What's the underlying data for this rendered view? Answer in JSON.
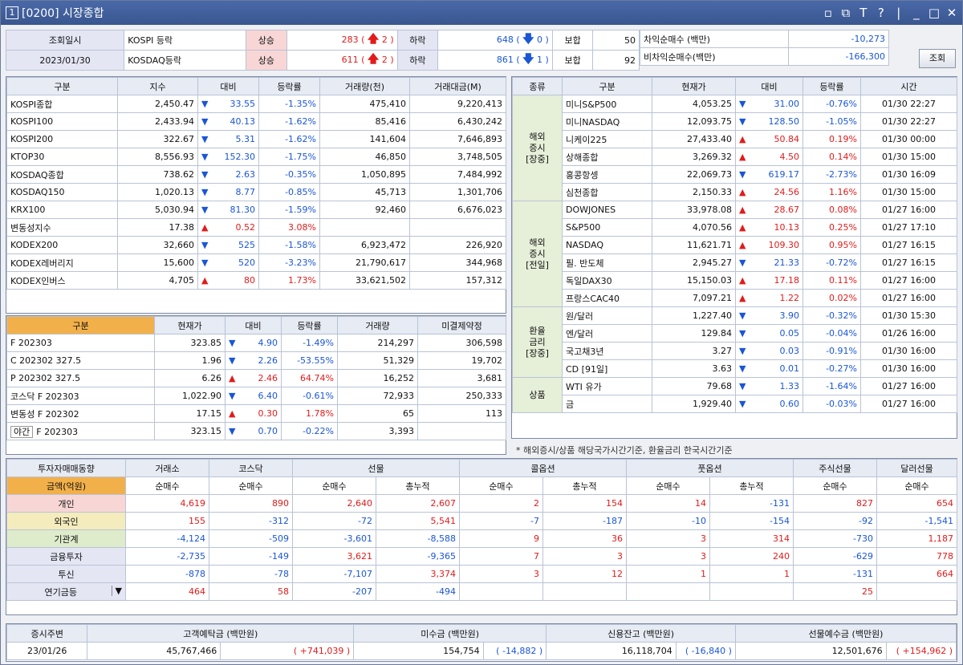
{
  "window": {
    "num": "1",
    "title": "[0200] 시장종합",
    "controls": [
      "⧉",
      "⧉",
      "T",
      "?",
      "|",
      "_",
      "□",
      "✕"
    ]
  },
  "top": {
    "date_label": "조회일시",
    "date": "2023/01/30",
    "rows": [
      {
        "name": "KOSPI 등락",
        "up_label": "상승",
        "up": "283",
        "up_limit": "2",
        "dn_label": "하락",
        "dn": "648",
        "dn_limit": "0",
        "flat_label": "보합",
        "flat": "50"
      },
      {
        "name": "KOSDAQ등락",
        "up_label": "상승",
        "up": "611",
        "up_limit": "2",
        "dn_label": "하락",
        "dn": "861",
        "dn_limit": "1",
        "flat_label": "보합",
        "flat": "92"
      }
    ],
    "arb": [
      {
        "label": "차익순매수  (백만)",
        "value": "-10,273"
      },
      {
        "label": "비차익순매수(백만)",
        "value": "-166,300"
      }
    ],
    "query_button": "조회"
  },
  "index": {
    "headers": [
      "구분",
      "지수",
      "대비",
      "등락률",
      "거래량(천)",
      "거래대금(M)"
    ],
    "rows": [
      {
        "name": "KOSPI종합",
        "val": "2,450.47",
        "dir": "dn",
        "chg": "33.55",
        "rate": "-1.35%",
        "vol": "475,410",
        "amt": "9,220,413"
      },
      {
        "name": "KOSPI100",
        "val": "2,433.94",
        "dir": "dn",
        "chg": "40.13",
        "rate": "-1.62%",
        "vol": "85,416",
        "amt": "6,430,242"
      },
      {
        "name": "KOSPI200",
        "val": "322.67",
        "dir": "dn",
        "chg": "5.31",
        "rate": "-1.62%",
        "vol": "141,604",
        "amt": "7,646,893"
      },
      {
        "name": "KTOP30",
        "val": "8,556.93",
        "dir": "dn",
        "chg": "152.30",
        "rate": "-1.75%",
        "vol": "46,850",
        "amt": "3,748,505"
      },
      {
        "name": "KOSDAQ종합",
        "val": "738.62",
        "dir": "dn",
        "chg": "2.63",
        "rate": "-0.35%",
        "vol": "1,050,895",
        "amt": "7,484,992"
      },
      {
        "name": "KOSDAQ150",
        "val": "1,020.13",
        "dir": "dn",
        "chg": "8.77",
        "rate": "-0.85%",
        "vol": "45,713",
        "amt": "1,301,706"
      },
      {
        "name": "KRX100",
        "val": "5,030.94",
        "dir": "dn",
        "chg": "81.30",
        "rate": "-1.59%",
        "vol": "92,460",
        "amt": "6,676,023"
      },
      {
        "name": "변동성지수",
        "val": "17.38",
        "dir": "up",
        "chg": "0.52",
        "rate": "3.08%",
        "vol": "",
        "amt": ""
      },
      {
        "name": "KODEX200",
        "val": "32,660",
        "dir": "dn",
        "chg": "525",
        "rate": "-1.58%",
        "vol": "6,923,472",
        "amt": "226,920"
      },
      {
        "name": "KODEX레버리지",
        "val": "15,600",
        "dir": "dn",
        "chg": "520",
        "rate": "-3.23%",
        "vol": "21,790,617",
        "amt": "344,968"
      },
      {
        "name": "KODEX인버스",
        "val": "4,705",
        "dir": "up",
        "chg": "80",
        "rate": "1.73%",
        "vol": "33,621,502",
        "amt": "157,312"
      }
    ]
  },
  "futures": {
    "headers": [
      "구분",
      "현재가",
      "대비",
      "등락률",
      "거래량",
      "미결제약정"
    ],
    "rows": [
      {
        "name": "F 202303",
        "val": "323.85",
        "dir": "dn",
        "chg": "4.90",
        "rate": "-1.49%",
        "vol": "214,297",
        "oi": "306,598"
      },
      {
        "name": "C 202302 327.5",
        "val": "1.96",
        "dir": "dn",
        "chg": "2.26",
        "rate": "-53.55%",
        "vol": "51,329",
        "oi": "19,702"
      },
      {
        "name": "P 202302 327.5",
        "val": "6.26",
        "dir": "up",
        "chg": "2.46",
        "rate": "64.74%",
        "vol": "16,252",
        "oi": "3,681"
      },
      {
        "name": "코스닥 F 202303",
        "val": "1,022.90",
        "dir": "dn",
        "chg": "6.40",
        "rate": "-0.61%",
        "vol": "72,933",
        "oi": "250,333"
      },
      {
        "name": "변동성 F 202302",
        "val": "17.15",
        "dir": "up",
        "chg": "0.30",
        "rate": "1.78%",
        "vol": "65",
        "oi": "113"
      }
    ],
    "night": {
      "tag": "야간",
      "name": "F 202303",
      "val": "323.15",
      "dir": "dn",
      "chg": "0.70",
      "rate": "-0.22%",
      "vol": "3,393",
      "oi": ""
    }
  },
  "world": {
    "headers": [
      "종류",
      "구분",
      "현재가",
      "대비",
      "등락률",
      "시간"
    ],
    "groups": [
      {
        "label": "해외\n증시\n[장중]",
        "rows": [
          {
            "name": "미니S&P500",
            "val": "4,053.25",
            "dir": "dn",
            "chg": "31.00",
            "rate": "-0.76%",
            "time": "01/30 22:27"
          },
          {
            "name": "미니NASDAQ",
            "val": "12,093.75",
            "dir": "dn",
            "chg": "128.50",
            "rate": "-1.05%",
            "time": "01/30 22:27"
          },
          {
            "name": "니케이225",
            "val": "27,433.40",
            "dir": "up",
            "chg": "50.84",
            "rate": "0.19%",
            "time": "01/30 00:00"
          },
          {
            "name": "상해종합",
            "val": "3,269.32",
            "dir": "up",
            "chg": "4.50",
            "rate": "0.14%",
            "time": "01/30 15:00"
          },
          {
            "name": "홍콩항셍",
            "val": "22,069.73",
            "dir": "dn",
            "chg": "619.17",
            "rate": "-2.73%",
            "time": "01/30 16:09"
          },
          {
            "name": "심천종합",
            "val": "2,150.33",
            "dir": "up",
            "chg": "24.56",
            "rate": "1.16%",
            "time": "01/30 15:00"
          }
        ]
      },
      {
        "label": "해외\n증시\n[전일]",
        "rows": [
          {
            "name": "DOWJONES",
            "val": "33,978.08",
            "dir": "up",
            "chg": "28.67",
            "rate": "0.08%",
            "time": "01/27 16:00"
          },
          {
            "name": "S&P500",
            "val": "4,070.56",
            "dir": "up",
            "chg": "10.13",
            "rate": "0.25%",
            "time": "01/27 17:10"
          },
          {
            "name": "NASDAQ",
            "val": "11,621.71",
            "dir": "up",
            "chg": "109.30",
            "rate": "0.95%",
            "time": "01/27 16:15"
          },
          {
            "name": "필. 반도체",
            "val": "2,945.27",
            "dir": "dn",
            "chg": "21.33",
            "rate": "-0.72%",
            "time": "01/27 16:15"
          },
          {
            "name": "독일DAX30",
            "val": "15,150.03",
            "dir": "up",
            "chg": "17.18",
            "rate": "0.11%",
            "time": "01/27 16:00"
          },
          {
            "name": "프랑스CAC40",
            "val": "7,097.21",
            "dir": "up",
            "chg": "1.22",
            "rate": "0.02%",
            "time": "01/27 16:00"
          }
        ]
      },
      {
        "label": "환율\n금리\n[장중]",
        "rows": [
          {
            "name": "원/달러",
            "val": "1,227.40",
            "dir": "dn",
            "chg": "3.90",
            "rate": "-0.32%",
            "time": "01/30 15:30"
          },
          {
            "name": "엔/달러",
            "val": "129.84",
            "dir": "dn",
            "chg": "0.05",
            "rate": "-0.04%",
            "time": "01/26 16:00"
          },
          {
            "name": "국고채3년",
            "val": "3.27",
            "dir": "dn",
            "chg": "0.03",
            "rate": "-0.91%",
            "time": "01/30 16:00"
          },
          {
            "name": "CD [91일]",
            "val": "3.63",
            "dir": "dn",
            "chg": "0.01",
            "rate": "-0.27%",
            "time": "01/30 16:00"
          }
        ]
      },
      {
        "label": "상품",
        "rows": [
          {
            "name": "WTI 유가",
            "val": "79.68",
            "dir": "dn",
            "chg": "1.33",
            "rate": "-1.64%",
            "time": "01/27 16:00"
          },
          {
            "name": "금",
            "val": "1,929.40",
            "dir": "dn",
            "chg": "0.60",
            "rate": "-0.03%",
            "time": "01/27 16:00"
          }
        ]
      }
    ],
    "note": "* 해외증시/상품 해당국가시간기준, 환율금리 한국시간기준"
  },
  "investor": {
    "top_headers": [
      "투자자매매동향",
      "거래소",
      "코스닥",
      "선물",
      "콜옵션",
      "풋옵션",
      "주식선물",
      "달러선물"
    ],
    "unit": "금액(억원)",
    "sub": [
      "순매수",
      "순매수",
      "순매수",
      "총누적",
      "순매수",
      "총누적",
      "순매수",
      "총누적",
      "순매수",
      "순매수"
    ],
    "rows": [
      {
        "name": "개인",
        "v": [
          "4,619",
          "890",
          "2,640",
          "2,607",
          "2",
          "154",
          "14",
          "-131",
          "827",
          "654"
        ]
      },
      {
        "name": "외국인",
        "v": [
          "155",
          "-312",
          "-72",
          "5,541",
          "-7",
          "-187",
          "-10",
          "-154",
          "-92",
          "-1,541"
        ]
      },
      {
        "name": "기관계",
        "v": [
          "-4,124",
          "-509",
          "-3,601",
          "-8,588",
          "9",
          "36",
          "3",
          "314",
          "-730",
          "1,187"
        ]
      },
      {
        "name": "금융투자",
        "v": [
          "-2,735",
          "-149",
          "3,621",
          "-9,365",
          "7",
          "3",
          "3",
          "240",
          "-629",
          "778"
        ]
      },
      {
        "name": "투신",
        "v": [
          "-878",
          "-78",
          "-7,107",
          "3,374",
          "3",
          "12",
          "1",
          "1",
          "-131",
          "664"
        ]
      },
      {
        "name": "연기금등",
        "v": [
          "464",
          "58",
          "-207",
          "-494",
          "",
          "",
          "",
          "",
          "25",
          ""
        ]
      }
    ]
  },
  "bottom": {
    "headers": [
      "증시주변",
      "고객예탁금 (백만원)",
      "미수금 (백만원)",
      "신용잔고 (백만원)",
      "선물예수금 (백만원)"
    ],
    "date": "23/01/26",
    "deposit": "45,767,466",
    "deposit_chg": "+741,039",
    "unpaid": "154,754",
    "unpaid_chg": "-14,882",
    "credit": "16,118,704",
    "credit_chg": "-16,840",
    "fut_dep": "12,501,676",
    "fut_dep_chg": "+154,962"
  },
  "colors": {
    "up": "#e21b1b",
    "down": "#1a56d6",
    "title": "#3f5e9c",
    "orange": "#f2b04a"
  }
}
